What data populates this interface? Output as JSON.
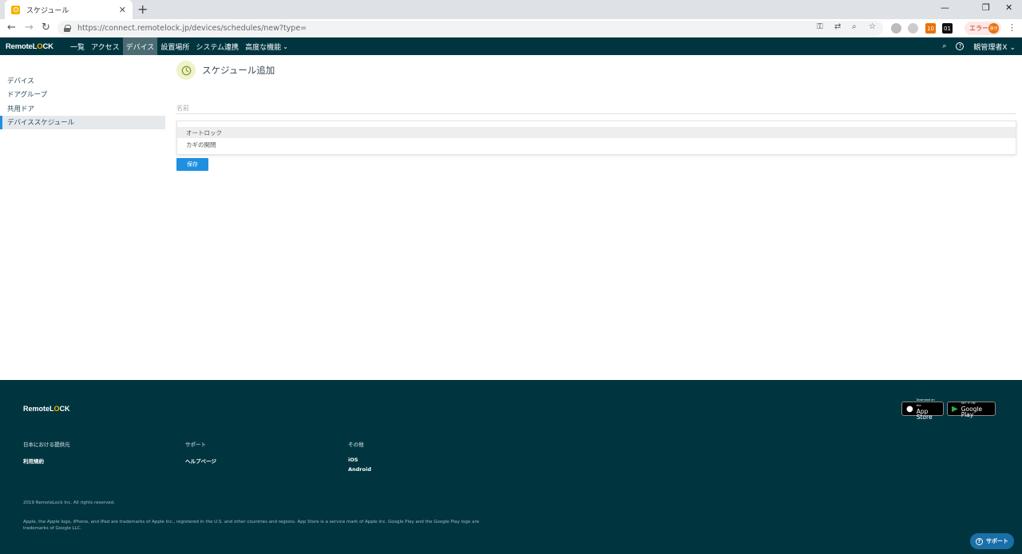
{
  "browser": {
    "tab_title": "スケジュール",
    "url": "https://connect.remotelock.jp/devices/schedules/new?type=",
    "extension_badge": "10",
    "extension_01": "01",
    "error_label": "エラー",
    "avatar_text": "蓮也"
  },
  "nav": {
    "logo_prefix": "Remote",
    "logo_l": "L",
    "logo_o": "O",
    "logo_rest": "CK",
    "items": [
      "一覧",
      "アクセス",
      "デバイス",
      "設置場所",
      "システム連携",
      "高度な機能"
    ],
    "advanced_caret": "⌄",
    "user": "観管理者X"
  },
  "sidebar": {
    "items": [
      "デバイス",
      "ドアグループ",
      "共用ドア",
      "デバイススケジュール"
    ]
  },
  "main": {
    "title": "スケジュール追加",
    "name_placeholder": "名前",
    "dropdown_options": [
      "オートロック",
      "カギの開閉"
    ],
    "save_label": "保存"
  },
  "footer": {
    "logo_prefix": "Remote",
    "logo_l": "L",
    "logo_o": "O",
    "logo_rest": "CK",
    "col1_head": "日本における提供元",
    "col1_link": "利用規約",
    "col2_head": "サポート",
    "col2_link": "ヘルプページ",
    "col3_head": "その他",
    "col3_links": [
      "iOS",
      "Android"
    ],
    "copyright": "2019 RemoteLock Inc. All rights reserved.",
    "legal": "Apple, the Apple logo, iPhone, and iPad are trademarks of Apple Inc., registered in the U.S. and other countries and regions. App Store is a service mark of Apple Inc. Google Play and the Google Play logo are trademarks of Google LLC.",
    "appstore_small": "Download on the",
    "appstore_large": "App Store",
    "gplay_small": "GET IT ON",
    "gplay_large": "Google Play",
    "support_label": "サポート"
  },
  "colors": {
    "nav_bg": "#00353f",
    "accent_blue": "#1f8fe0",
    "logo_yellow": "#f5b400"
  }
}
